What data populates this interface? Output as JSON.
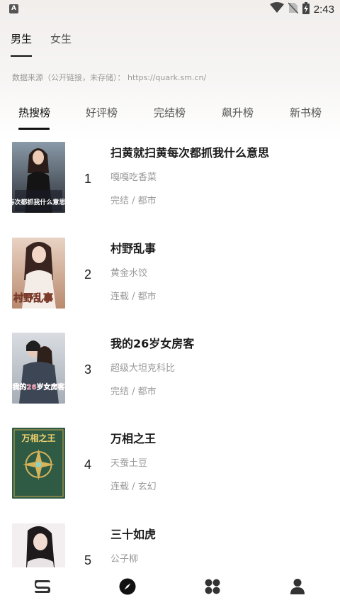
{
  "status_bar": {
    "time": "2:43",
    "notification_icon": "a-notification-icon",
    "icons": [
      "wifi-icon",
      "no-sim-icon",
      "battery-charging-icon"
    ]
  },
  "gender_tabs": [
    {
      "label": "男生",
      "active": true
    },
    {
      "label": "女生",
      "active": false
    }
  ],
  "source_note": "数据来源（公开链接，未存储）： https://quark.sm.cn/",
  "rank_tabs": [
    {
      "label": "热搜榜",
      "active": true
    },
    {
      "label": "好评榜",
      "active": false
    },
    {
      "label": "完结榜",
      "active": false
    },
    {
      "label": "飙升榜",
      "active": false
    },
    {
      "label": "新书榜",
      "active": false
    }
  ],
  "books": [
    {
      "rank": "1",
      "title": "扫黄就扫黄每次都抓我什么意思",
      "author": "嘎嘎吃香菜",
      "meta": "完结 / 都市",
      "cover_text": "每次都抓我什么意思?"
    },
    {
      "rank": "2",
      "title": "村野乱事",
      "author": "黄金水饺",
      "meta": "连载 / 都市",
      "cover_text": "村野乱事"
    },
    {
      "rank": "3",
      "title": "我的26岁女房客",
      "author": "超级大坦克科比",
      "meta": "完结 / 都市",
      "cover_text": "我的26岁女房客"
    },
    {
      "rank": "4",
      "title": "万相之王",
      "author": "天蚕土豆",
      "meta": "连载 / 玄幻",
      "cover_text": "万相之王"
    },
    {
      "rank": "5",
      "title": "三十如虎",
      "author": "公子柳",
      "meta": "",
      "cover_text": ""
    }
  ],
  "bottom_nav": [
    {
      "icon": "bookshelf-icon",
      "active": false
    },
    {
      "icon": "compass-icon",
      "active": true
    },
    {
      "icon": "category-grid-icon",
      "active": false
    },
    {
      "icon": "profile-icon",
      "active": false
    }
  ],
  "colors": {
    "text_primary": "#1a1a1a",
    "text_secondary": "#9a9a9a",
    "accent": "#111111"
  }
}
